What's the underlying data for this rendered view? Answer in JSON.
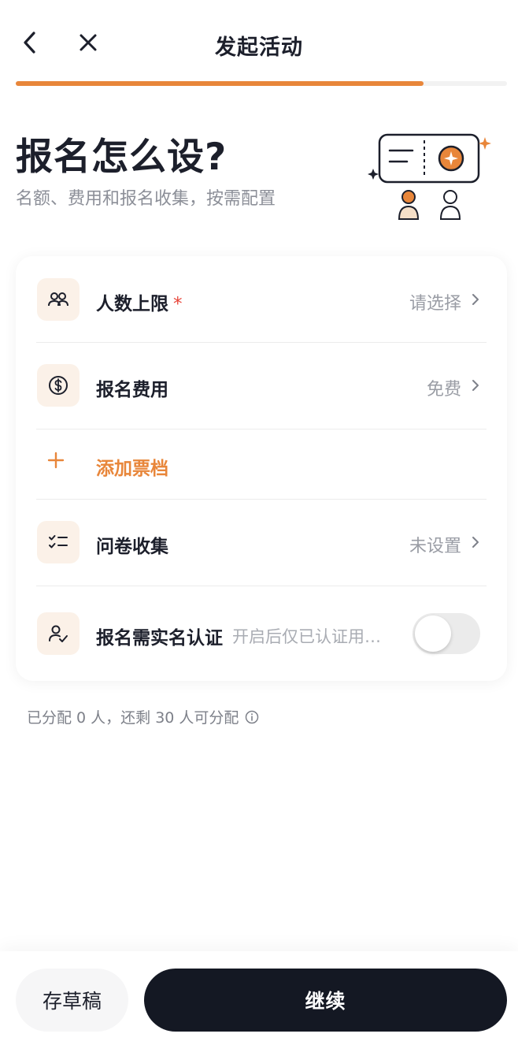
{
  "header": {
    "title": "发起活动",
    "progress_fraction": 0.83
  },
  "hero": {
    "title": "报名怎么设?",
    "subtitle": "名额、费用和报名收集，按需配置"
  },
  "rows": {
    "capacity": {
      "label": "人数上限",
      "required_mark": "*",
      "value": "请选择",
      "icon": "users-icon"
    },
    "fee": {
      "label": "报名费用",
      "value": "免费",
      "icon": "dollar-circle-icon"
    },
    "add_ticket": {
      "label": "添加票档",
      "icon": "plus-icon"
    },
    "questionnaire": {
      "label": "问卷收集",
      "value": "未设置",
      "icon": "checklist-icon"
    },
    "realname": {
      "label": "报名需实名认证",
      "hint": "开启后仅已认证用…",
      "icon": "user-check-icon",
      "toggle_on": false
    }
  },
  "allocation_note": "已分配 0 人，还剩 30 人可分配",
  "footer": {
    "draft_label": "存草稿",
    "continue_label": "继续"
  },
  "colors": {
    "accent": "#e8863a",
    "primary_dark": "#141823",
    "icon_bg": "#fbf1e8",
    "required": "#e8463a"
  }
}
